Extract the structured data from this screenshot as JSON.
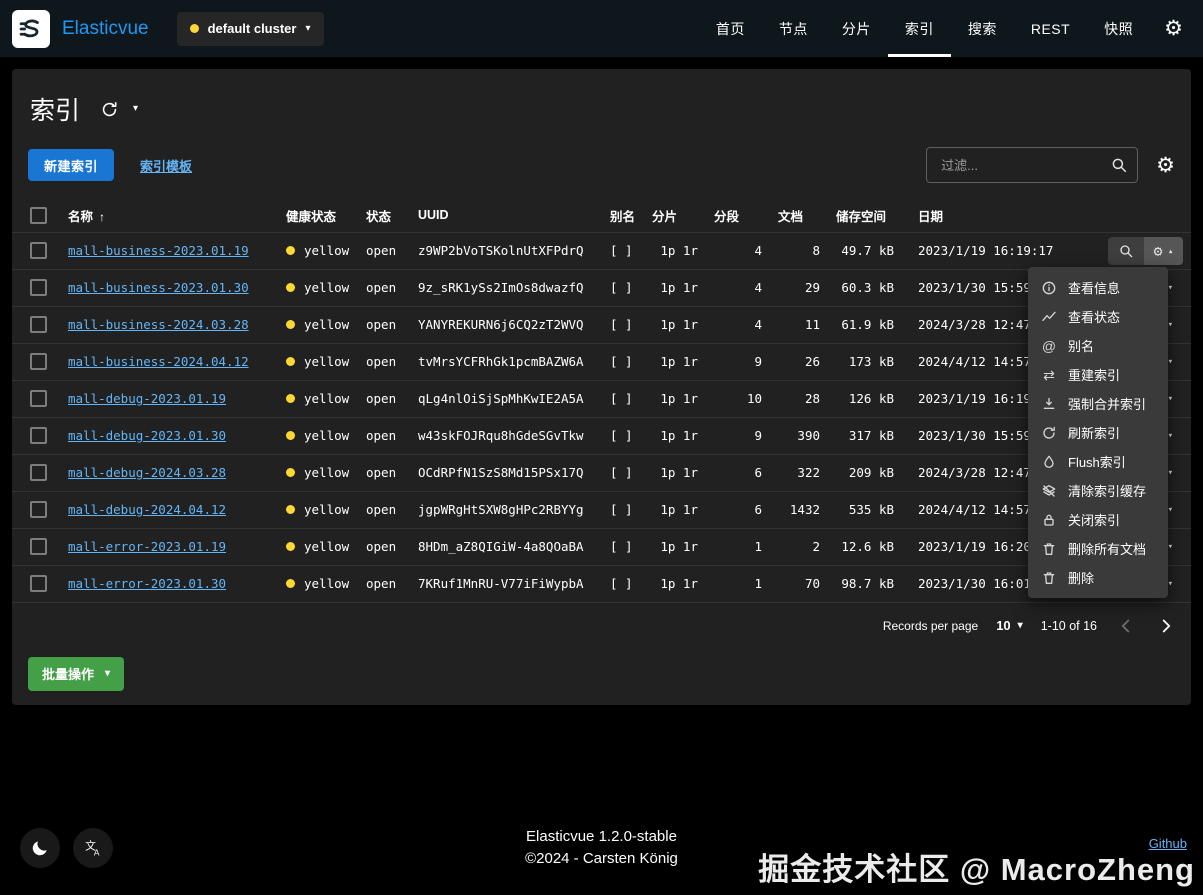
{
  "navbar": {
    "brand": "Elasticvue",
    "cluster_button": {
      "label": "default cluster"
    },
    "items": [
      {
        "label": "首页"
      },
      {
        "label": "节点"
      },
      {
        "label": "分片"
      },
      {
        "label": "索引"
      },
      {
        "label": "搜索"
      },
      {
        "label": "REST"
      },
      {
        "label": "快照"
      }
    ]
  },
  "page": {
    "title": "索引"
  },
  "toolbar": {
    "new_index_button": "新建索引",
    "index_templates_link": "索引模板",
    "filter_placeholder": "过滤..."
  },
  "table": {
    "headers": {
      "name": "名称",
      "health": "健康状态",
      "status": "状态",
      "uuid": "UUID",
      "aliases": "别名",
      "shards": "分片",
      "segments": "分段",
      "docs": "文档",
      "storage": "储存空间",
      "date": "日期"
    },
    "rows": [
      {
        "name": "mall-business-2023.01.19",
        "health": "yellow",
        "status": "open",
        "uuid": "z9WP2bVoTSKolnUtXFPdrQ",
        "aliases": "[ ]",
        "shards": "1p 1r",
        "segments": "4",
        "docs": "8",
        "storage": "49.7 kB",
        "date": "2023/1/19 16:19:17"
      },
      {
        "name": "mall-business-2023.01.30",
        "health": "yellow",
        "status": "open",
        "uuid": "9z_sRK1ySs2ImOs8dwazfQ",
        "aliases": "[ ]",
        "shards": "1p 1r",
        "segments": "4",
        "docs": "29",
        "storage": "60.3 kB",
        "date": "2023/1/30 15:59:"
      },
      {
        "name": "mall-business-2024.03.28",
        "health": "yellow",
        "status": "open",
        "uuid": "YANYREKURN6j6CQ2zT2WVQ",
        "aliases": "[ ]",
        "shards": "1p 1r",
        "segments": "4",
        "docs": "11",
        "storage": "61.9 kB",
        "date": "2024/3/28 12:47:"
      },
      {
        "name": "mall-business-2024.04.12",
        "health": "yellow",
        "status": "open",
        "uuid": "tvMrsYCFRhGk1pcmBAZW6A",
        "aliases": "[ ]",
        "shards": "1p 1r",
        "segments": "9",
        "docs": "26",
        "storage": "173 kB",
        "date": "2024/4/12 14:57:"
      },
      {
        "name": "mall-debug-2023.01.19",
        "health": "yellow",
        "status": "open",
        "uuid": "qLg4nlOiSjSpMhKwIE2A5A",
        "aliases": "[ ]",
        "shards": "1p 1r",
        "segments": "10",
        "docs": "28",
        "storage": "126 kB",
        "date": "2023/1/19 16:19:"
      },
      {
        "name": "mall-debug-2023.01.30",
        "health": "yellow",
        "status": "open",
        "uuid": "w43skFOJRqu8hGdeSGvTkw",
        "aliases": "[ ]",
        "shards": "1p 1r",
        "segments": "9",
        "docs": "390",
        "storage": "317 kB",
        "date": "2023/1/30 15:59:"
      },
      {
        "name": "mall-debug-2024.03.28",
        "health": "yellow",
        "status": "open",
        "uuid": "OCdRPfN1SzS8Md15PSx17Q",
        "aliases": "[ ]",
        "shards": "1p 1r",
        "segments": "6",
        "docs": "322",
        "storage": "209 kB",
        "date": "2024/3/28 12:47:"
      },
      {
        "name": "mall-debug-2024.04.12",
        "health": "yellow",
        "status": "open",
        "uuid": "jgpWRgHtSXW8gHPc2RBYYg",
        "aliases": "[ ]",
        "shards": "1p 1r",
        "segments": "6",
        "docs": "1432",
        "storage": "535 kB",
        "date": "2024/4/12 14:57:"
      },
      {
        "name": "mall-error-2023.01.19",
        "health": "yellow",
        "status": "open",
        "uuid": "8HDm_aZ8QIGiW-4a8QOaBA",
        "aliases": "[ ]",
        "shards": "1p 1r",
        "segments": "1",
        "docs": "2",
        "storage": "12.6 kB",
        "date": "2023/1/19 16:20:"
      },
      {
        "name": "mall-error-2023.01.30",
        "health": "yellow",
        "status": "open",
        "uuid": "7KRuf1MnRU-V77iFiWypbA",
        "aliases": "[ ]",
        "shards": "1p 1r",
        "segments": "1",
        "docs": "70",
        "storage": "98.7 kB",
        "date": "2023/1/30 16:01:"
      }
    ]
  },
  "action_menu": {
    "items": [
      {
        "icon": "info-icon",
        "label": "查看信息"
      },
      {
        "icon": "stats-icon",
        "label": "查看状态"
      },
      {
        "icon": "alias-icon",
        "label": "别名"
      },
      {
        "icon": "reindex-icon",
        "label": "重建索引"
      },
      {
        "icon": "force-merge-icon",
        "label": "强制合并索引"
      },
      {
        "icon": "refresh-icon",
        "label": "刷新索引"
      },
      {
        "icon": "flush-icon",
        "label": "Flush索引"
      },
      {
        "icon": "clear-cache-icon",
        "label": "清除索引缓存"
      },
      {
        "icon": "close-index-icon",
        "label": "关闭索引"
      },
      {
        "icon": "delete-docs-icon",
        "label": "删除所有文档"
      },
      {
        "icon": "delete-icon",
        "label": "删除"
      }
    ]
  },
  "pagination": {
    "records_per_page_label": "Records per page",
    "per_page": "10",
    "range": "1-10 of 16"
  },
  "bulk": {
    "label": "批量操作"
  },
  "footer": {
    "version": "Elasticvue 1.2.0-stable",
    "copyright": "©2024 - Carsten König",
    "github_link": "Github",
    "watermark": "掘金技术社区 @ MacroZheng"
  },
  "colors": {
    "accent_blue": "#1976d2",
    "link_blue": "#64b5f6",
    "health_yellow": "#fdd835",
    "bulk_green": "#43a047",
    "navbar_bg": "#0e181c",
    "card_bg": "#212121"
  }
}
